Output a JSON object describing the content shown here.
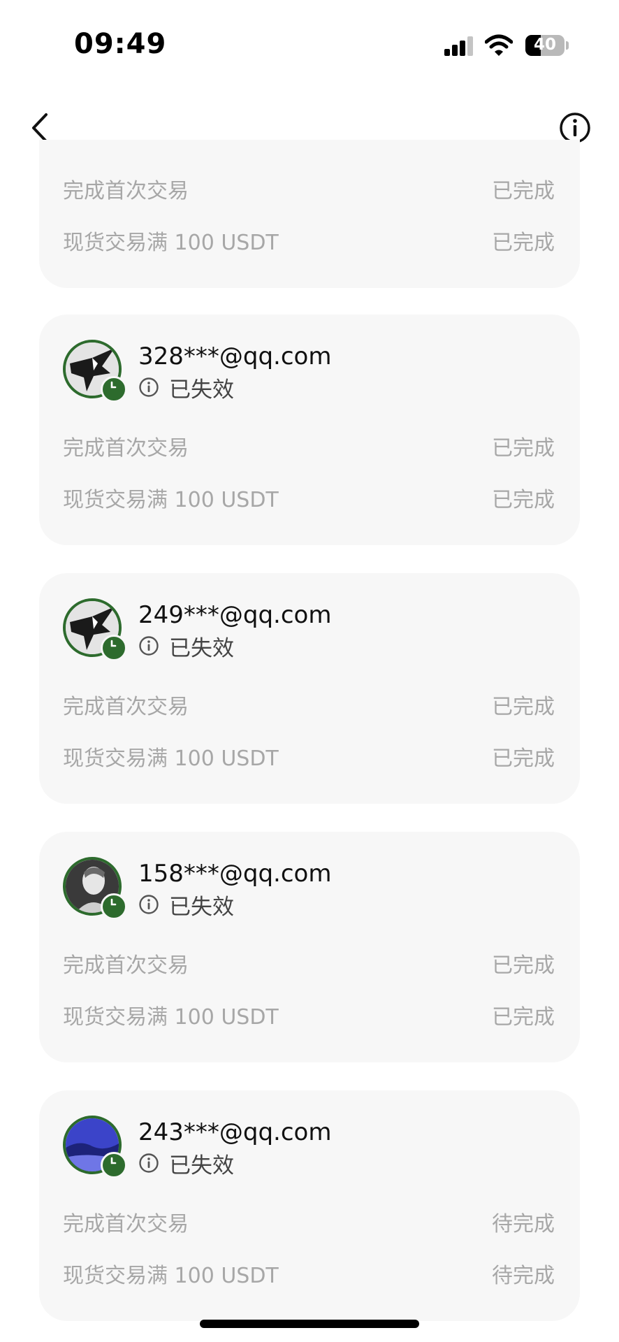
{
  "status_bar": {
    "time": "09:49",
    "battery_level": "40"
  },
  "partial_card": {
    "tasks": [
      {
        "label": "完成首次交易",
        "status": "已完成"
      },
      {
        "label": "现货交易满 100 USDT",
        "status": "已完成"
      }
    ]
  },
  "invites": [
    {
      "email": "328***@qq.com",
      "status": "已失效",
      "avatar": "eagle-avatar",
      "tasks": [
        {
          "label": "完成首次交易",
          "status": "已完成"
        },
        {
          "label": "现货交易满 100 USDT",
          "status": "已完成"
        }
      ]
    },
    {
      "email": "249***@qq.com",
      "status": "已失效",
      "avatar": "eagle-avatar",
      "tasks": [
        {
          "label": "完成首次交易",
          "status": "已完成"
        },
        {
          "label": "现货交易满 100 USDT",
          "status": "已完成"
        }
      ]
    },
    {
      "email": "158***@qq.com",
      "status": "已失效",
      "avatar": "portrait-avatar",
      "tasks": [
        {
          "label": "完成首次交易",
          "status": "已完成"
        },
        {
          "label": "现货交易满 100 USDT",
          "status": "已完成"
        }
      ]
    },
    {
      "email": "243***@qq.com",
      "status": "已失效",
      "avatar": "landscape-avatar",
      "tasks": [
        {
          "label": "完成首次交易",
          "status": "待完成"
        },
        {
          "label": "现货交易满 100 USDT",
          "status": "待完成"
        }
      ]
    }
  ],
  "colors": {
    "card_bg": "#f7f7f7",
    "muted_text": "#a7a7a7",
    "badge_green": "#2d6b2d"
  }
}
